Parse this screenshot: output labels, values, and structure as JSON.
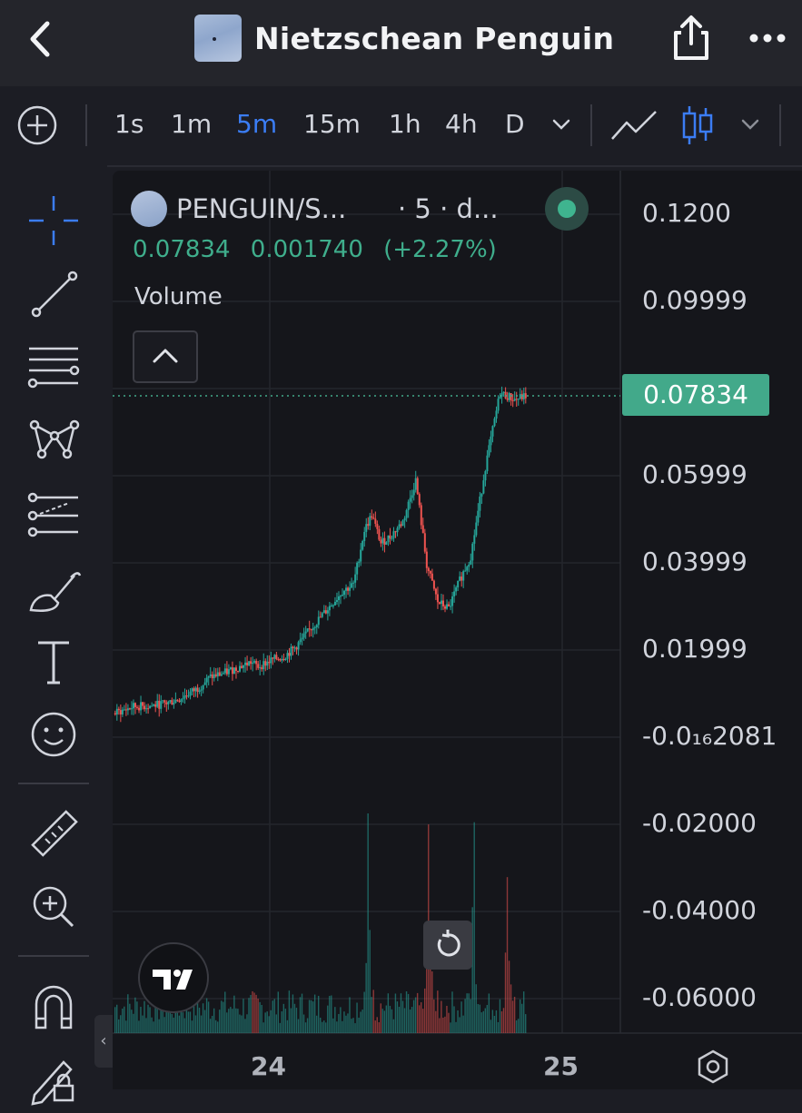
{
  "header": {
    "title": "Nietzschean Penguin",
    "back_icon": "chevron-left-icon",
    "share_icon": "share-icon",
    "more_icon": "more-dots-icon"
  },
  "toolbar": {
    "intervals": [
      "1s",
      "1m",
      "5m",
      "15m",
      "1h",
      "4h",
      "D"
    ],
    "active_interval": "5m",
    "interval_dropdown_icon": "chevron-down-icon",
    "chart_style_icons": [
      "line-chart-icon",
      "candlestick-icon"
    ],
    "add_icon": "add-circle-icon"
  },
  "drawing_tools": [
    "crosshair-icon",
    "trend-line-icon",
    "fib-retracement-icon",
    "pattern-icon",
    "prediction-icon",
    "brush-icon",
    "text-icon",
    "emoji-icon",
    "ruler-icon",
    "zoom-in-icon",
    "magnet-icon",
    "lock-drawing-icon"
  ],
  "legend": {
    "symbol": "PENGUIN/S...",
    "interval": "· 5 · d...",
    "last": "0.07834",
    "change": "0.001740",
    "change_pct": "(+2.27%)",
    "volume_label": "Volume"
  },
  "price_axis": {
    "labels": [
      "0.1200",
      "0.09999",
      "0.05999",
      "0.03999",
      "0.01999",
      "-0.0₁₆2081",
      "-0.02000",
      "-0.04000",
      "-0.06000"
    ],
    "last_price": "0.07834"
  },
  "time_axis": {
    "labels": [
      "24",
      "25"
    ]
  },
  "colors": {
    "up": "#26a69a",
    "down": "#ef5350",
    "accent": "#3b7df4",
    "last_price_bg": "#42a98a"
  },
  "chart_data": {
    "type": "candlestick",
    "symbol": "PENGUIN/S...",
    "interval": "5",
    "ylim": [
      -0.07,
      0.125
    ],
    "y_ticks": [
      0.12,
      0.09999,
      0.07834,
      0.05999,
      0.03999,
      0.01999,
      0.0,
      -0.02,
      -0.04,
      -0.06
    ],
    "x_ticks": [
      "24",
      "25"
    ],
    "last_price": 0.07834,
    "price_path": [
      [
        0,
        0.0055
      ],
      [
        10,
        0.007
      ],
      [
        20,
        0.0072
      ],
      [
        28,
        0.0078
      ],
      [
        35,
        0.0088
      ],
      [
        45,
        0.0112
      ],
      [
        52,
        0.0138
      ],
      [
        60,
        0.0148
      ],
      [
        68,
        0.0162
      ],
      [
        74,
        0.0172
      ],
      [
        78,
        0.0162
      ],
      [
        86,
        0.0178
      ],
      [
        92,
        0.0185
      ],
      [
        98,
        0.0205
      ],
      [
        104,
        0.0235
      ],
      [
        110,
        0.0265
      ],
      [
        118,
        0.0305
      ],
      [
        124,
        0.0335
      ],
      [
        130,
        0.035
      ],
      [
        136,
        0.0475
      ],
      [
        140,
        0.051
      ],
      [
        145,
        0.0445
      ],
      [
        150,
        0.046
      ],
      [
        157,
        0.0495
      ],
      [
        164,
        0.059
      ],
      [
        170,
        0.0395
      ],
      [
        176,
        0.031
      ],
      [
        182,
        0.0295
      ],
      [
        188,
        0.036
      ],
      [
        194,
        0.0415
      ],
      [
        202,
        0.062
      ],
      [
        210,
        0.079
      ],
      [
        218,
        0.0775
      ],
      [
        224,
        0.0783
      ]
    ],
    "volume": {
      "peaks": [
        [
          138,
          1.0
        ],
        [
          171,
          0.95
        ],
        [
          196,
          0.96
        ],
        [
          214,
          0.71
        ],
        [
          230,
          0.54
        ]
      ],
      "baseline": 0.15
    }
  }
}
